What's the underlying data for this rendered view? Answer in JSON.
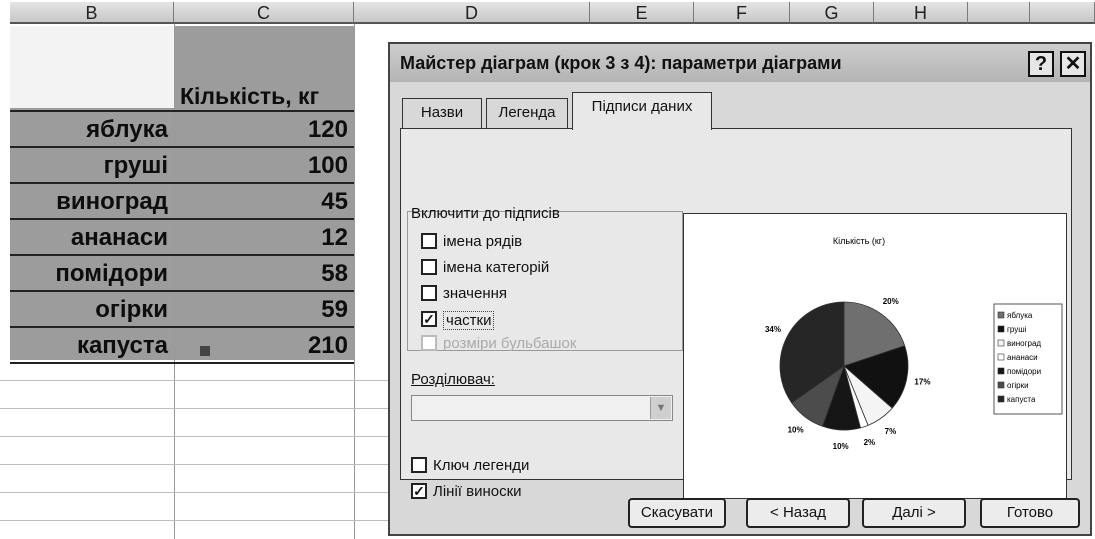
{
  "sheet": {
    "columns": [
      "B",
      "C",
      "D",
      "E",
      "F",
      "G",
      "H"
    ],
    "header_cell": "Кількість, кг",
    "rows": [
      {
        "name": "яблука",
        "value": "120"
      },
      {
        "name": "груші",
        "value": "100"
      },
      {
        "name": "виноград",
        "value": "45"
      },
      {
        "name": "ананаси",
        "value": "12"
      },
      {
        "name": "помідори",
        "value": "58"
      },
      {
        "name": "огірки",
        "value": "59"
      },
      {
        "name": "капуста",
        "value": "210"
      }
    ]
  },
  "dialog": {
    "title": "Майстер діаграм (крок 3 з 4): параметри діаграми",
    "help_label": "?",
    "close_label": "✕",
    "tabs": [
      "Назви",
      "Легенда",
      "Підписи даних"
    ],
    "active_tab": "Підписи даних",
    "include_group_label": "Включити до підписів",
    "options": [
      {
        "label": "імена рядів",
        "checked": false,
        "enabled": true
      },
      {
        "label": "імена категорій",
        "checked": false,
        "enabled": true
      },
      {
        "label": "значення",
        "checked": false,
        "enabled": true
      },
      {
        "label": "частки",
        "checked": true,
        "enabled": true
      },
      {
        "label": "розміри бульбашок",
        "checked": false,
        "enabled": false
      }
    ],
    "separator_label": "Розділювач:",
    "legend_key_label": "Ключ легенди",
    "legend_key_checked": false,
    "leader_lines_label": "Лінії виноски",
    "leader_lines_checked": true,
    "buttons": {
      "cancel": "Скасувати",
      "back": "< Назад",
      "next": "Далі >",
      "finish": "Готово"
    }
  },
  "chart_data": {
    "type": "pie",
    "title": "Кількість (кг)",
    "categories": [
      "яблука",
      "груші",
      "виноград",
      "ананаси",
      "помідори",
      "огірки",
      "капуста"
    ],
    "values": [
      120,
      100,
      45,
      12,
      58,
      59,
      210
    ],
    "data_labels": [
      "20%",
      "17%",
      "7%",
      "2%",
      "10%",
      "10%",
      "34%"
    ],
    "colors": [
      "#6f6f6f",
      "#111111",
      "#f4f4f4",
      "#ffffff",
      "#161616",
      "#4c4c4c",
      "#262626"
    ],
    "legend": "right"
  }
}
